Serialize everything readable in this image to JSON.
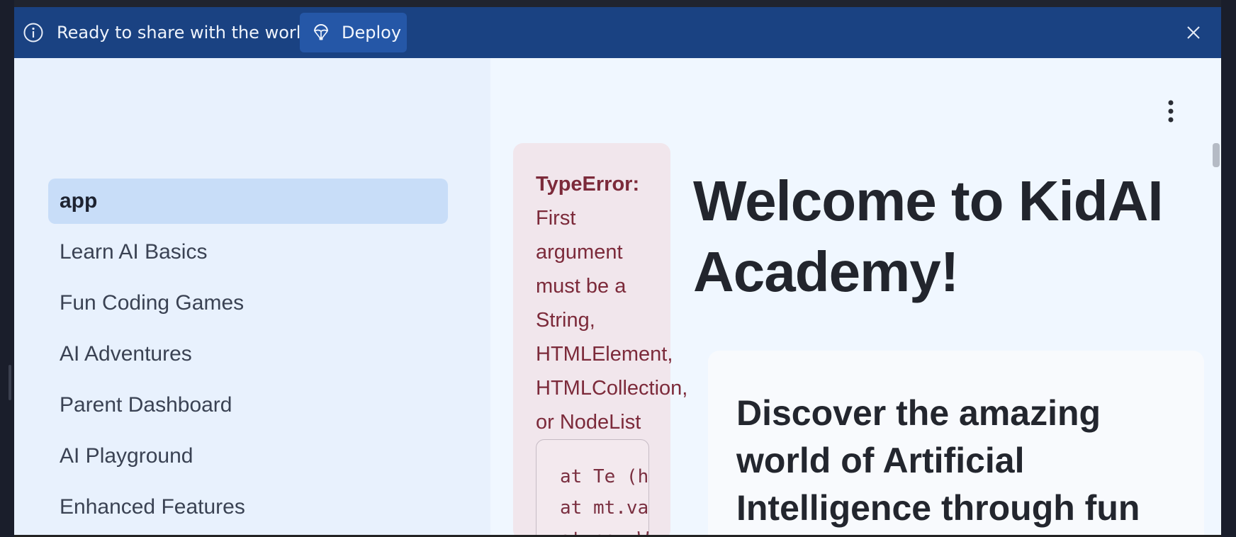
{
  "banner": {
    "message": "Ready to share with the world?",
    "deploy_label": "Deploy",
    "background": "#1a4282"
  },
  "sidebar": {
    "items": [
      {
        "label": "app",
        "active": true
      },
      {
        "label": "Learn AI Basics"
      },
      {
        "label": "Fun Coding Games"
      },
      {
        "label": "AI Adventures"
      },
      {
        "label": "Parent Dashboard"
      },
      {
        "label": "AI Playground"
      },
      {
        "label": "Enhanced Features"
      }
    ]
  },
  "error": {
    "type": "TypeError:",
    "message_lines": [
      "First",
      "argument",
      "must be a",
      "String,",
      "HTMLElement,",
      "HTMLCollection,",
      "or NodeList"
    ],
    "stack_lines": [
      "at Te (h",
      "at mt.va",
      "at new W"
    ]
  },
  "main": {
    "title_line1": "Welcome to KidAI",
    "title_line2": "Academy!",
    "card_heading_lines": [
      "Discover the amazing",
      "world of Artificial",
      "Intelligence through fun"
    ]
  }
}
